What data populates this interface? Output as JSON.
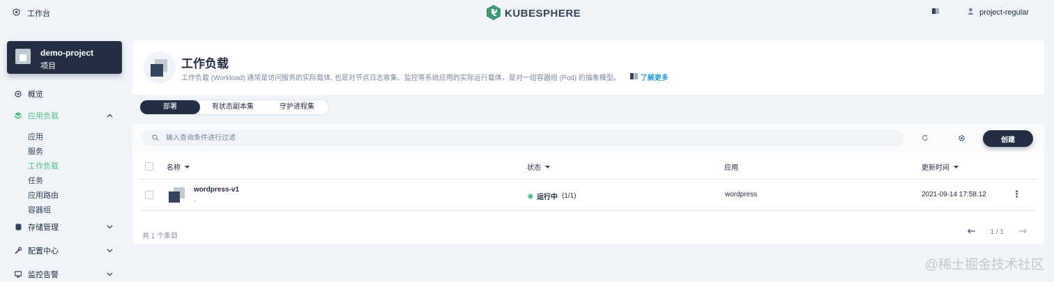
{
  "topbar": {
    "workbench_label": "工作台",
    "logo_text": "KUBESPHERE",
    "user_name": "project-regular"
  },
  "sidebar": {
    "project": {
      "name": "demo-project",
      "type": "项目"
    },
    "items": [
      {
        "label": "概览"
      },
      {
        "label": "应用负载",
        "active": true
      },
      {
        "label": "存储管理"
      },
      {
        "label": "配置中心"
      },
      {
        "label": "监控告警"
      }
    ],
    "subitems": [
      {
        "label": "应用"
      },
      {
        "label": "服务"
      },
      {
        "label": "工作负载",
        "active": true
      },
      {
        "label": "任务"
      },
      {
        "label": "应用路由"
      },
      {
        "label": "容器组"
      }
    ]
  },
  "header": {
    "title": "工作负载",
    "description": "工作负载 (Workload) 通常是访问服务的实际载体, 也是对节点日志收集、监控等系统应用的实际运行载体，是对一组容器组 (Pod) 的抽象模型。",
    "learn_more": "了解更多"
  },
  "tabs": [
    {
      "label": "部署",
      "active": true
    },
    {
      "label": "有状态副本集"
    },
    {
      "label": "守护进程集"
    }
  ],
  "toolbar": {
    "search_placeholder": "输入查询条件进行过滤",
    "create_label": "创建"
  },
  "table": {
    "columns": [
      "名称",
      "状态",
      "应用",
      "更新时间"
    ],
    "rows": [
      {
        "name": "wordpress-v1",
        "desc": "-",
        "status": "运行中",
        "replicas": "(1/1)",
        "app": "wordpress",
        "updated": "2021-09-14 17:58:12"
      }
    ],
    "total": "共 1 个条目",
    "page": "1 / 1"
  },
  "watermark": "@稀土掘金技术社区",
  "colors": {
    "primary": "#242e42",
    "accent_green": "#55bc8a",
    "link_blue": "#329dce",
    "background": "#eff4f9"
  }
}
